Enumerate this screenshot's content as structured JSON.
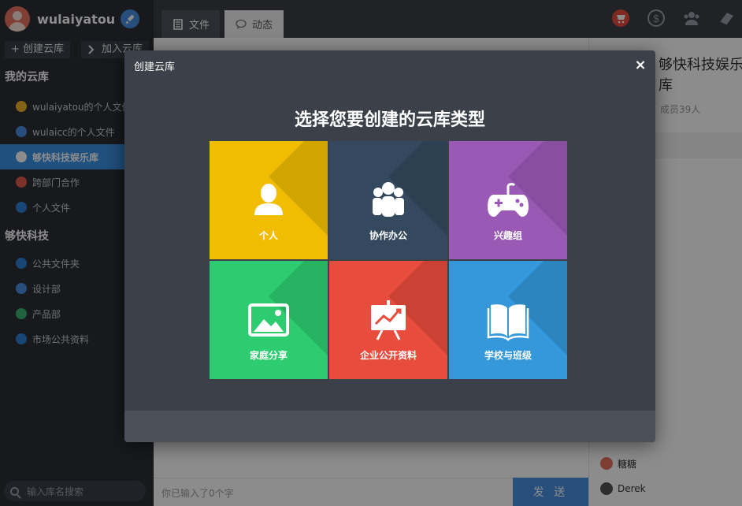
{
  "sidebar": {
    "username": "wulaiyatou",
    "actions": {
      "create": "+ 创建云库",
      "join": "加入云库"
    },
    "sections": [
      {
        "title": "我的云库",
        "items": [
          {
            "label": "wulaiyatou的个人文件",
            "color": "#f0b429",
            "active": false
          },
          {
            "label": "wulaicc的个人文件",
            "color": "#4a90e2",
            "active": false
          },
          {
            "label": "够快科技娱乐库",
            "color": "#4a90e2",
            "active": true
          },
          {
            "label": "跨部门合作",
            "color": "#e35b4c",
            "active": false
          },
          {
            "label": "个人文件",
            "color": "#2e82d6",
            "active": false
          }
        ]
      },
      {
        "title": "够快科技",
        "items": [
          {
            "label": "公共文件夹",
            "color": "#2e82d6",
            "active": false
          },
          {
            "label": "设计部",
            "color": "#4a90e2",
            "active": false
          },
          {
            "label": "产品部",
            "color": "#3cb371",
            "active": false
          },
          {
            "label": "市场公共资料",
            "color": "#2e82d6",
            "active": false
          }
        ]
      }
    ],
    "search_placeholder": "输入库名搜索"
  },
  "topbar": {
    "tabs": [
      {
        "label": "文件"
      },
      {
        "label": "动态"
      }
    ],
    "icons": [
      "cart-icon",
      "dollar-icon",
      "team-icon",
      "book-icon"
    ]
  },
  "main": {
    "input_placeholder": "你已输入了0个字",
    "send_label": "发 送"
  },
  "right": {
    "title": "够快科技娱乐库",
    "members_count": "成员39人",
    "member_list": [
      {
        "name": "糖糖",
        "color": "#e8745f"
      },
      {
        "name": "Derek",
        "color": "#555555"
      }
    ]
  },
  "modal": {
    "header": "创建云库",
    "close": "×",
    "heading": "选择您要创建的云库类型",
    "tiles": [
      {
        "label": "个人",
        "color": "#f0bd00",
        "icon": "person-icon"
      },
      {
        "label": "协作办公",
        "color": "#34495e",
        "icon": "group-icon"
      },
      {
        "label": "兴趣组",
        "color": "#9b59b6",
        "icon": "gamepad-icon"
      },
      {
        "label": "家庭分享",
        "color": "#2ecc71",
        "icon": "picture-icon"
      },
      {
        "label": "企业公开资料",
        "color": "#e74c3c",
        "icon": "presentation-icon"
      },
      {
        "label": "学校与班级",
        "color": "#3498db",
        "icon": "open-book-icon"
      }
    ]
  }
}
